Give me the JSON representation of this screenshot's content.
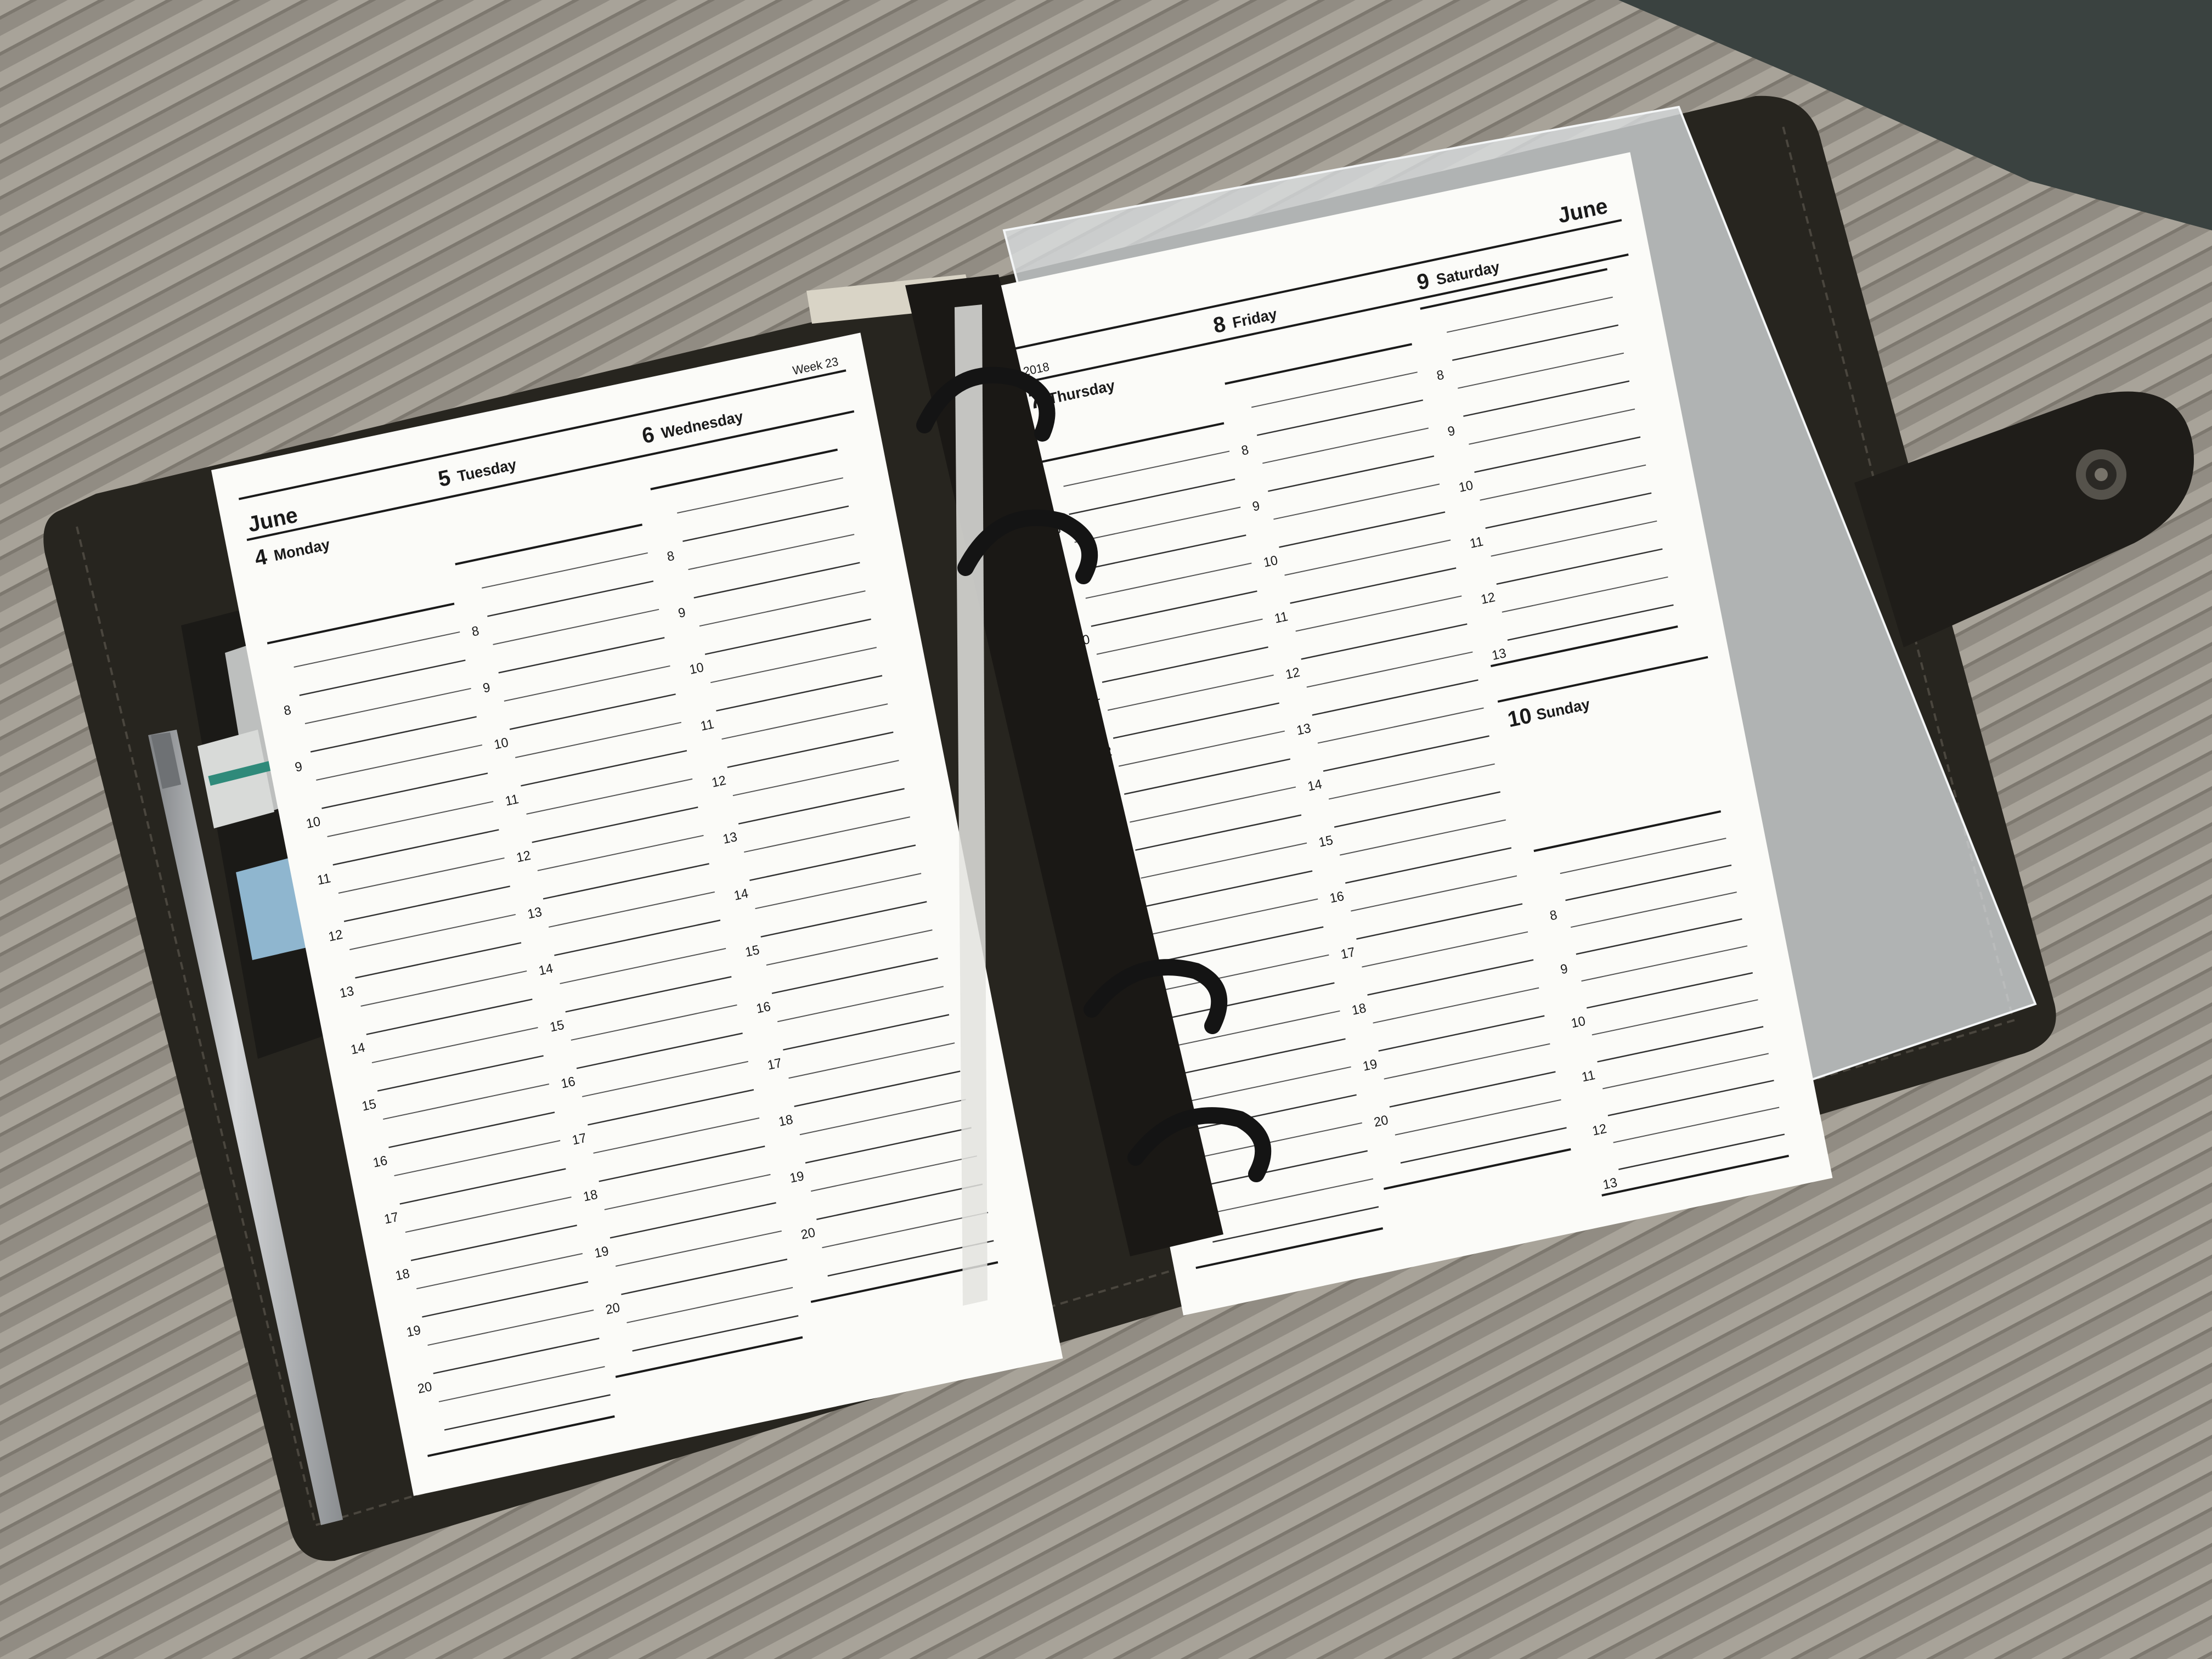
{
  "colors": {
    "fabric": "#8f8a81",
    "leather": "#27251f",
    "paper": "#fbfbf8",
    "ink": "#1a1a1a",
    "ring": "#141414",
    "pen": "#a9acae"
  },
  "icons": [
    "binder-ring-icon",
    "snap-button-icon",
    "pen-icon"
  ],
  "left_page": {
    "month": "June",
    "week": "Week 23",
    "days": [
      {
        "num": "4",
        "name": "Monday"
      },
      {
        "num": "5",
        "name": "Tuesday"
      },
      {
        "num": "6",
        "name": "Wednesday"
      }
    ],
    "hours": [
      "8",
      "9",
      "10",
      "11",
      "12",
      "13",
      "14",
      "15",
      "16",
      "17",
      "18",
      "19",
      "20"
    ]
  },
  "right_page": {
    "year": "2018",
    "month": "June",
    "days": [
      {
        "num": "7",
        "name": "Thursday"
      },
      {
        "num": "8",
        "name": "Friday"
      },
      {
        "num": "9",
        "name": "Saturday"
      },
      {
        "num": "10",
        "name": "Sunday"
      }
    ],
    "hours": [
      "8",
      "9",
      "10",
      "11",
      "12",
      "13",
      "14",
      "15",
      "16",
      "17",
      "18",
      "19",
      "20"
    ]
  }
}
